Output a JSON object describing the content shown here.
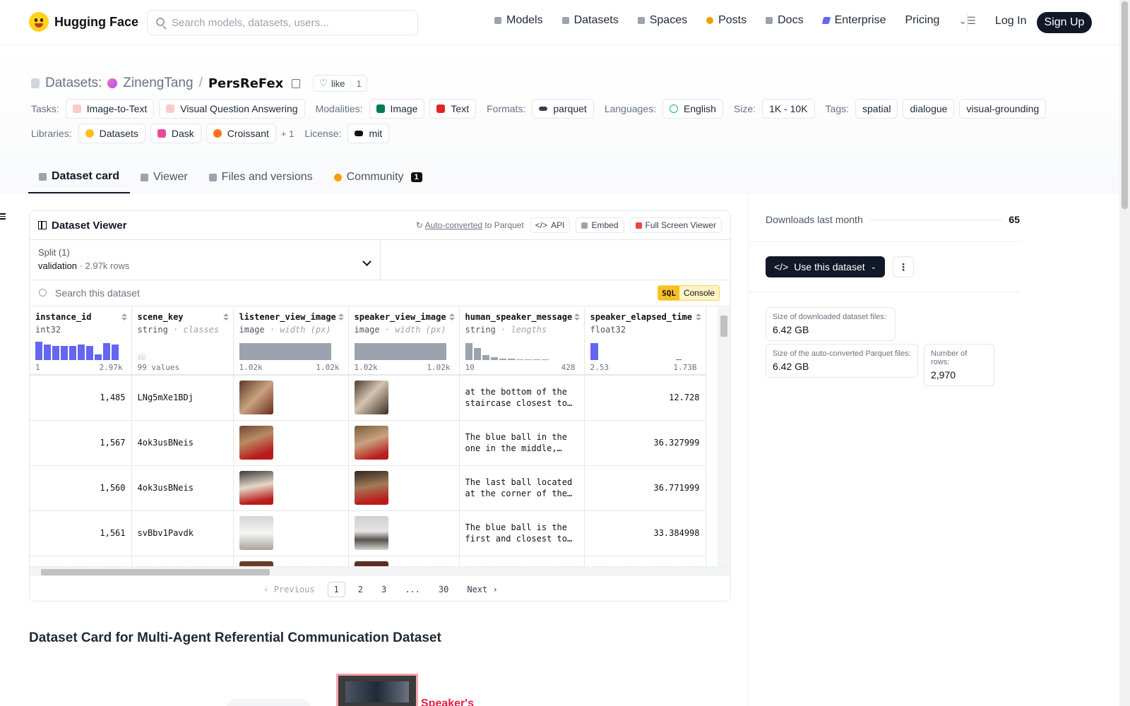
{
  "nav": {
    "brand": "Hugging Face",
    "search_placeholder": "Search models, datasets, users...",
    "links": [
      "Models",
      "Datasets",
      "Spaces",
      "Posts",
      "Docs",
      "Enterprise",
      "Pricing"
    ],
    "login": "Log In",
    "signup": "Sign Up"
  },
  "header": {
    "section": "Datasets:",
    "org": "ZinengTang",
    "slash": "/",
    "name": "PersReFex",
    "like_label": "like",
    "like_count": "1"
  },
  "tags": {
    "tasks_label": "Tasks:",
    "tasks": [
      "Image-to-Text",
      "Visual Question Answering"
    ],
    "modalities_label": "Modalities:",
    "modalities": [
      "Image",
      "Text"
    ],
    "formats_label": "Formats:",
    "formats": [
      "parquet"
    ],
    "languages_label": "Languages:",
    "languages": [
      "English"
    ],
    "size_label": "Size:",
    "size": "1K - 10K",
    "tags_label": "Tags:",
    "tags": [
      "spatial",
      "dialogue",
      "visual-grounding"
    ],
    "libraries_label": "Libraries:",
    "libraries": [
      "Datasets",
      "Dask",
      "Croissant"
    ],
    "libraries_more": "+ 1",
    "license_label": "License:",
    "license": "mit"
  },
  "tabs": [
    "Dataset card",
    "Viewer",
    "Files and versions",
    "Community"
  ],
  "community_count": "1",
  "viewer": {
    "title": "Dataset Viewer",
    "auto_converted": "Auto-converted",
    "to_parquet": "to Parquet",
    "api": "API",
    "embed": "Embed",
    "fullscreen": "Full Screen Viewer",
    "split_label": "Split (1)",
    "split_name": "validation",
    "split_sep": "·",
    "split_rows": "2.97k rows",
    "search_placeholder": "Search this dataset",
    "sql": "SQL",
    "console": "Console",
    "columns": [
      {
        "name": "instance_id",
        "type": "int32",
        "sub": "",
        "min": "1",
        "max": "2.97k"
      },
      {
        "name": "scene_key",
        "type": "string",
        "sub": "· classes",
        "min": "99 values",
        "max": ""
      },
      {
        "name": "listener_view_image",
        "type": "image",
        "sub": "· width (px)",
        "min": "1.02k",
        "max": "1.02k"
      },
      {
        "name": "speaker_view_image",
        "type": "image",
        "sub": "· width (px)",
        "min": "1.02k",
        "max": "1.02k"
      },
      {
        "name": "human_speaker_message",
        "type": "string",
        "sub": "· lengths",
        "min": "10",
        "max": "428"
      },
      {
        "name": "speaker_elapsed_time",
        "type": "float32",
        "sub": "",
        "min": "2.53",
        "max": "1.73B"
      }
    ],
    "rows": [
      {
        "instance_id": "1,485",
        "scene_key": "LNg5mXe1BDj",
        "message": "at the bottom of the staircase closest to…",
        "elapsed": "12.728"
      },
      {
        "instance_id": "1,567",
        "scene_key": "4ok3usBNeis",
        "message": "The blue ball in the one in the middle,…",
        "elapsed": "36.327999"
      },
      {
        "instance_id": "1,560",
        "scene_key": "4ok3usBNeis",
        "message": "The last ball located at the corner of the…",
        "elapsed": "36.771999"
      },
      {
        "instance_id": "1,561",
        "scene_key": "svBbv1Pavdk",
        "message": "The blue ball is the first and closest to…",
        "elapsed": "33.384998"
      }
    ],
    "pager": {
      "prev": "Previous",
      "pages": [
        "1",
        "2",
        "3",
        "...",
        "30"
      ],
      "next": "Next"
    }
  },
  "card_title": "Dataset Card for Multi-Agent Referential Communication Dataset",
  "preview_caption": "Speaker's",
  "sidebar": {
    "downloads_label": "Downloads last month",
    "downloads_value": "65",
    "use_button": "Use this dataset",
    "stats": [
      {
        "label": "Size of downloaded dataset files:",
        "value": "6.42 GB"
      },
      {
        "label": "Size of the auto-converted Parquet files:",
        "value": "6.42 GB"
      },
      {
        "label": "Number of rows:",
        "value": "2,970"
      }
    ]
  }
}
